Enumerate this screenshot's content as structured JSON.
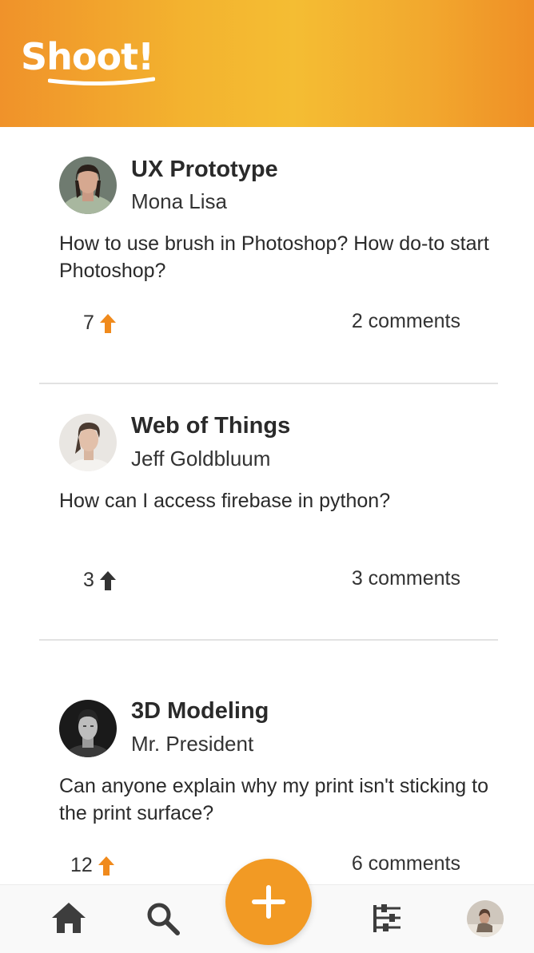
{
  "app": {
    "logo_text": "Shoot!"
  },
  "colors": {
    "brand_orange": "#f29a24",
    "brand_yellow": "#f4bd33",
    "upvote_active": "#f08a1c",
    "upvote_inactive": "#333333"
  },
  "posts": [
    {
      "title": "UX Prototype",
      "author": "Mona Lisa",
      "question": "How to use brush in Photoshop? How do-to start Photoshop?",
      "votes": "7",
      "upvoted": true,
      "comments": "2 comments",
      "avatar": "woman-green-sweater"
    },
    {
      "title": "Web of Things",
      "author": "Jeff Goldbluum",
      "question": "How can I access firebase in python?",
      "votes": "3",
      "upvoted": false,
      "comments": "3 comments",
      "avatar": "woman-white-top"
    },
    {
      "title": "3D Modeling",
      "author": "Mr. President",
      "question": "Can anyone explain why my print isn't sticking to the print surface?",
      "votes": "12",
      "upvoted": true,
      "comments": "6 comments",
      "avatar": "man-black-and-white"
    }
  ],
  "bottom_nav": {
    "items": [
      "home-icon",
      "search-icon",
      "add-icon",
      "filter-icon",
      "profile-avatar"
    ]
  }
}
